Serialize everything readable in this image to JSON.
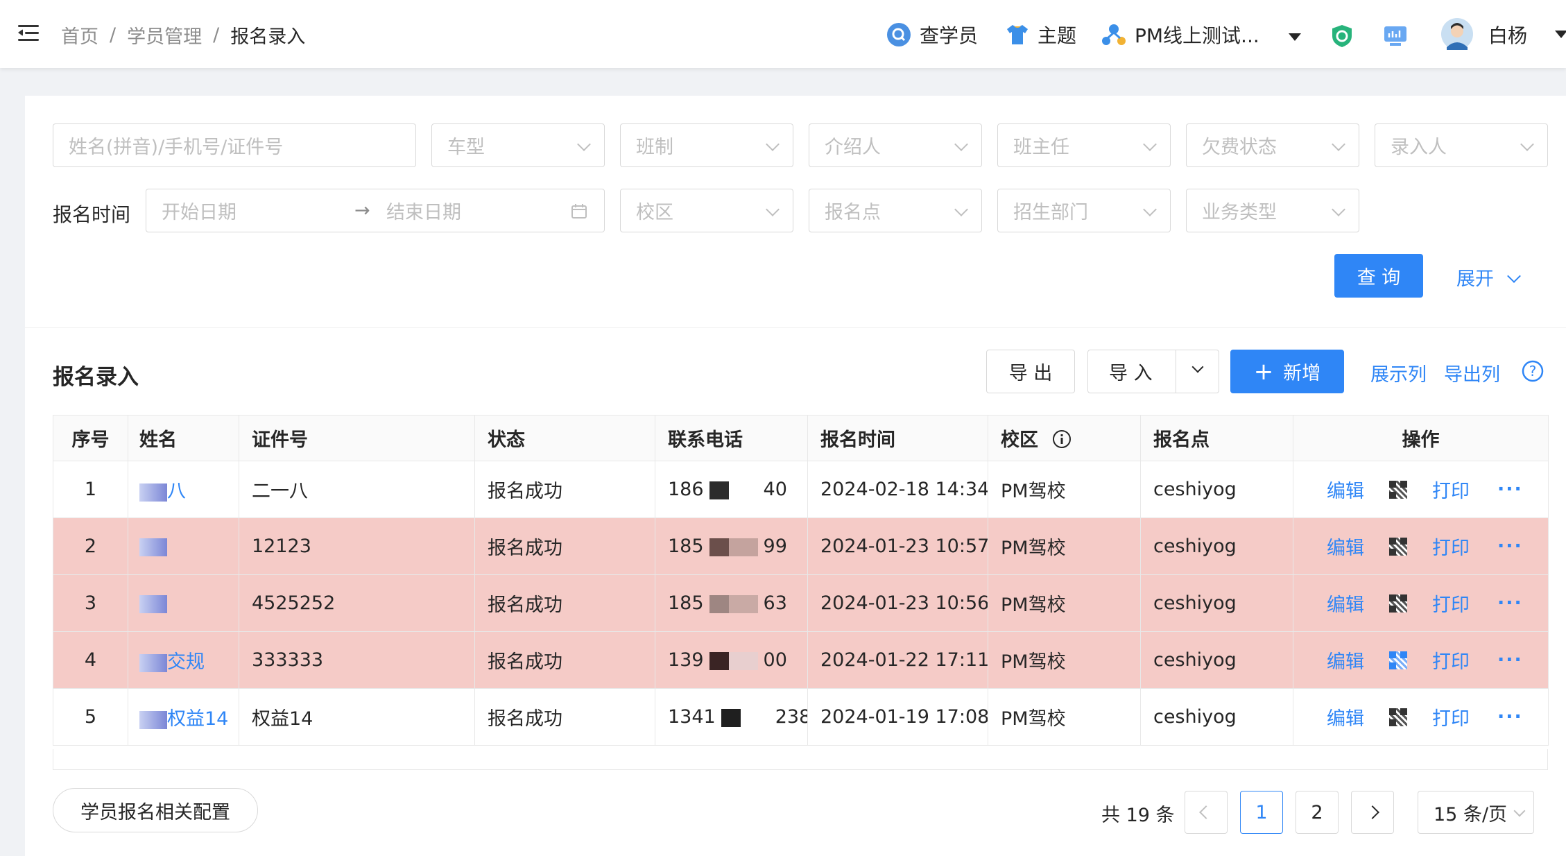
{
  "header": {
    "breadcrumb": [
      "首页",
      "学员管理",
      "报名录入"
    ],
    "search_student": "查学员",
    "theme": "主题",
    "org": "PM线上测试...",
    "user": "白杨"
  },
  "filters": {
    "keyword_placeholder": "姓名(拼音)/手机号/证件号",
    "car_type": "车型",
    "class_type": "班制",
    "referrer": "介绍人",
    "head_teacher": "班主任",
    "arrears": "欠费状态",
    "entered_by": "录入人",
    "date_label": "报名时间",
    "start_date": "开始日期",
    "end_date": "结束日期",
    "campus": "校区",
    "signup_point": "报名点",
    "recruit_dept": "招生部门",
    "biz_type": "业务类型",
    "query": "查 询",
    "expand": "展开"
  },
  "section": {
    "title": "报名录入",
    "export": "导 出",
    "import": "导 入",
    "add": "新增",
    "show_cols": "展示列",
    "export_cols": "导出列"
  },
  "table": {
    "columns": [
      "序号",
      "姓名",
      "证件号",
      "状态",
      "联系电话",
      "报名时间",
      "校区",
      "报名点",
      "操作"
    ],
    "rows": [
      {
        "idx": "1",
        "name": "八",
        "id_no": "二一八",
        "status": "报名成功",
        "phone_a": "186",
        "phone_b": "40",
        "time": "2024-02-18 14:34",
        "campus": "PM驾校",
        "point": "ceshiyog",
        "highlight": false
      },
      {
        "idx": "2",
        "name": "",
        "id_no": "12123",
        "status": "报名成功",
        "phone_a": "185",
        "phone_b": "99",
        "time": "2024-01-23 10:57",
        "campus": "PM驾校",
        "point": "ceshiyog",
        "highlight": true
      },
      {
        "idx": "3",
        "name": "",
        "id_no": "4525252",
        "status": "报名成功",
        "phone_a": "185",
        "phone_b": "63",
        "time": "2024-01-23 10:56",
        "campus": "PM驾校",
        "point": "ceshiyog",
        "highlight": true
      },
      {
        "idx": "4",
        "name": "交规",
        "id_no": "333333",
        "status": "报名成功",
        "phone_a": "139",
        "phone_b": "00",
        "time": "2024-01-22 17:11",
        "campus": "PM驾校",
        "point": "ceshiyog",
        "highlight": true
      },
      {
        "idx": "5",
        "name": "权益14",
        "id_no": "权益14",
        "status": "报名成功",
        "phone_a": "1341",
        "phone_b": "238",
        "time": "2024-01-19 17:08",
        "campus": "PM驾校",
        "point": "ceshiyog",
        "highlight": false
      }
    ],
    "op_edit": "编辑",
    "op_print": "打印"
  },
  "footer": {
    "config": "学员报名相关配置",
    "total": "共 19 条",
    "page1": "1",
    "page2": "2",
    "page_size": "15 条/页"
  }
}
